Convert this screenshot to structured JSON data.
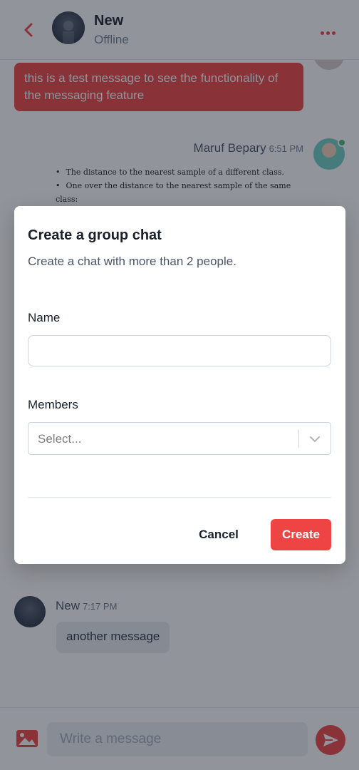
{
  "colors": {
    "accent": "#ef4444",
    "online": "#48bb78",
    "overlay": "rgba(26,32,44,0.48)"
  },
  "header": {
    "name": "New",
    "status": "Offline",
    "back_icon": "chevron-left-icon",
    "menu_icon": "more-horizontal-icon"
  },
  "messages": {
    "outgoing_text": "this is a test message to see the functionality of the messaging feature",
    "shared": {
      "sender": "Maruf Bepary",
      "time": "6:51 PM",
      "doc_lines": [
        "The distance to the nearest sample of a different class.",
        "One over the distance to the nearest sample of the same class:"
      ],
      "doc_fraction": "1"
    },
    "incoming": {
      "sender": "New",
      "time": "7:17 PM",
      "text": "another message"
    }
  },
  "composer": {
    "placeholder": "Write a message",
    "image_icon": "image-icon",
    "send_icon": "send-icon"
  },
  "modal": {
    "title": "Create a group chat",
    "subtitle": "Create a chat with more than 2 people.",
    "name_label": "Name",
    "name_value": "",
    "members_label": "Members",
    "members_placeholder": "Select...",
    "cancel_label": "Cancel",
    "create_label": "Create"
  }
}
